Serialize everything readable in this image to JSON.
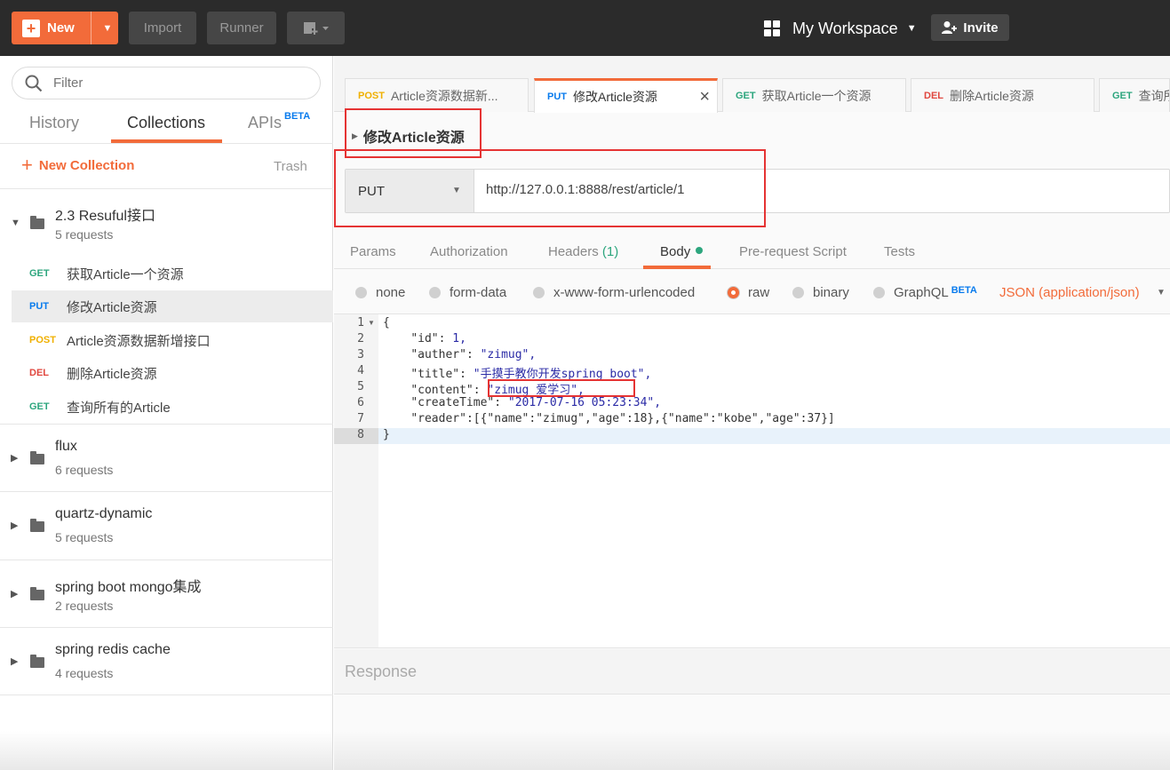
{
  "topbar": {
    "new_label": "New",
    "import_label": "Import",
    "runner_label": "Runner",
    "workspace_label": "My Workspace",
    "invite_label": "Invite"
  },
  "sidebar": {
    "filter_placeholder": "Filter",
    "tabs": [
      {
        "label": "History",
        "active": false
      },
      {
        "label": "Collections",
        "active": true
      },
      {
        "label": "APIs",
        "badge": "BETA",
        "active": false
      }
    ],
    "new_collection_label": "New Collection",
    "trash_label": "Trash",
    "collections": [
      {
        "name": "2.3 Resuful接口",
        "count": "5 requests",
        "expanded": true,
        "requests": [
          {
            "method": "GET",
            "name": "获取Article一个资源"
          },
          {
            "method": "PUT",
            "name": "修改Article资源",
            "selected": true
          },
          {
            "method": "POST",
            "name": "Article资源数据新增接口"
          },
          {
            "method": "DEL",
            "name": "删除Article资源"
          },
          {
            "method": "GET",
            "name": "查询所有的Article"
          }
        ]
      },
      {
        "name": "flux",
        "count": "6 requests"
      },
      {
        "name": "quartz-dynamic",
        "count": "5 requests"
      },
      {
        "name": "spring boot mongo集成",
        "count": "2 requests"
      },
      {
        "name": "spring redis cache",
        "count": "4 requests"
      }
    ]
  },
  "tabs": [
    {
      "method": "POST",
      "label": "Article资源数据新..."
    },
    {
      "method": "PUT",
      "label": "修改Article资源",
      "active": true
    },
    {
      "method": "GET",
      "label": "获取Article一个资源"
    },
    {
      "method": "DEL",
      "label": "删除Article资源"
    },
    {
      "method": "GET",
      "label": "查询所"
    }
  ],
  "request": {
    "title": "修改Article资源",
    "method": "PUT",
    "url": "http://127.0.0.1:8888/rest/article/1"
  },
  "subtabs": {
    "params": "Params",
    "authorization": "Authorization",
    "headers": "Headers",
    "headers_count": "(1)",
    "body": "Body",
    "prerequest": "Pre-request Script",
    "tests": "Tests"
  },
  "body_options": {
    "none": "none",
    "form_data": "form-data",
    "urlencoded": "x-www-form-urlencoded",
    "raw": "raw",
    "binary": "binary",
    "graphql": "GraphQL",
    "graphql_badge": "BETA",
    "content_type": "JSON (application/json)",
    "selected": "raw"
  },
  "editor": {
    "line_numbers": [
      "1",
      "2",
      "3",
      "4",
      "5",
      "6",
      "7",
      "8"
    ],
    "lines": [
      {
        "k": "",
        "v": "{"
      },
      {
        "k": "\"id\"",
        "v": "1,"
      },
      {
        "k": "\"auther\"",
        "v": "\"zimug\","
      },
      {
        "k": "\"title\"",
        "v": "\"手摸手教你开发spring boot\","
      },
      {
        "k": "\"content\"",
        "v": "\"zimug 爱学习\","
      },
      {
        "k": "\"createTime\"",
        "v": "\"2017-07-16 05:23:34\","
      },
      {
        "k": "\"reader\"",
        "v": "[{\"name\":\"zimug\",\"age\":18},{\"name\":\"kobe\",\"age\":37}]"
      },
      {
        "k": "",
        "v": "}"
      }
    ]
  },
  "response_label": "Response",
  "colors": {
    "accent": "#f26b3a",
    "get": "#2da67e",
    "put": "#097bed",
    "post": "#f0b000",
    "del": "#e0473f",
    "highlight": "#e53333"
  }
}
